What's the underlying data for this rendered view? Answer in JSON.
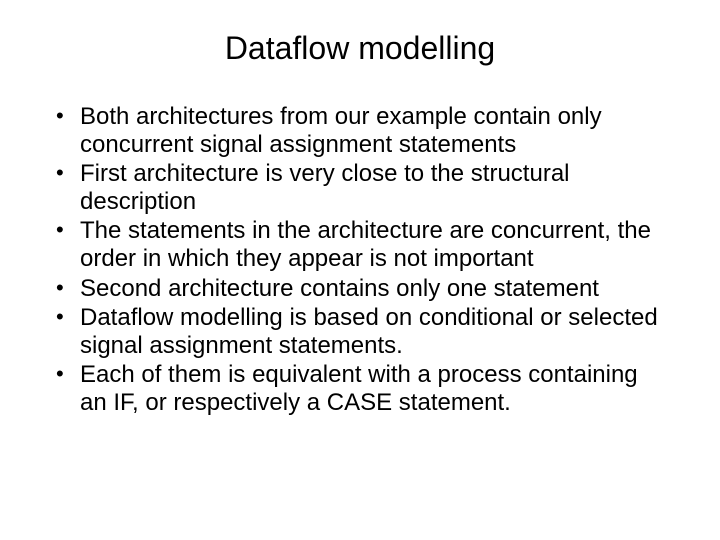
{
  "title": "Dataflow modelling",
  "bullets": [
    "Both architectures from our example contain only concurrent signal assignment statements",
    "First architecture is very close to the structural description",
    "The statements in the architecture are concurrent, the order in which they appear is not important",
    "Second architecture contains only one statement",
    "Dataflow modelling is based on conditional or selected signal assignment statements.",
    "Each of them is equivalent with a process containing an IF, or respectively a CASE statement."
  ]
}
